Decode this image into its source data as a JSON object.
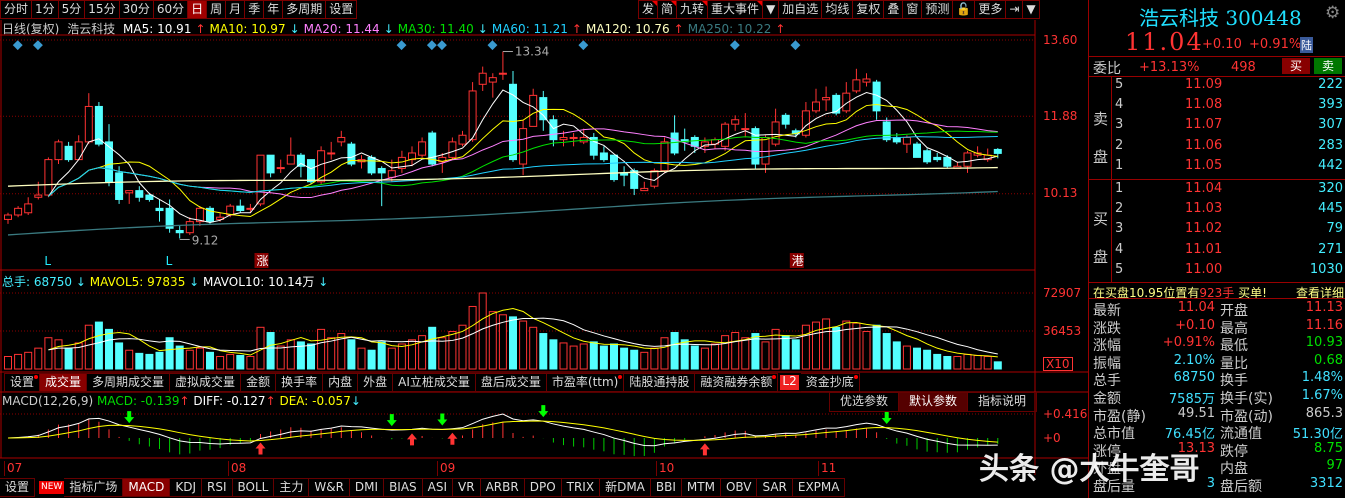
{
  "toolbar": {
    "left": [
      "分时",
      "1分",
      "5分",
      "15分",
      "30分",
      "60分",
      "日",
      "周",
      "月",
      "季",
      "年",
      "多周期",
      "设置"
    ],
    "active": "日",
    "right": [
      "发",
      "简",
      "九转",
      "重大事件",
      "▼",
      "加自选",
      "均线",
      "复权",
      "叠",
      "窗",
      "预测",
      "🔓",
      "更多",
      "⇥",
      "▼"
    ]
  },
  "ma_legend": {
    "prefix": "日线(复权)",
    "name": "浩云科技",
    "items": [
      {
        "label": "MA5: 10.91",
        "dir": "↑",
        "color": "#ffffff"
      },
      {
        "label": "MA10: 10.97",
        "dir": "↓",
        "color": "#ffff00"
      },
      {
        "label": "MA20: 11.44",
        "dir": "↓",
        "color": "#ff80ff"
      },
      {
        "label": "MA30: 11.40",
        "dir": "↓",
        "color": "#00e000"
      },
      {
        "label": "MA60: 11.21",
        "dir": "↑",
        "color": "#20d0ff"
      },
      {
        "label": "MA120: 10.76",
        "dir": "↑",
        "color": "#ffffc0"
      },
      {
        "label": "MA250: 10.22",
        "dir": "↑",
        "color": "#3a7a80"
      }
    ]
  },
  "price_axis": [
    "13.60",
    "11.88",
    "10.13"
  ],
  "vol_legend": {
    "total": "总手: 68750",
    "mavol5": "MAVOL5: 97835",
    "mavol10": "MAVOL10: 10.14万"
  },
  "vol_axis": [
    "72907",
    "36453"
  ],
  "vol_unit": "X10",
  "indicator_tabs": [
    "设置",
    "成交量",
    "多周期成交量",
    "虚拟成交量",
    "金额",
    "换手率",
    "内盘",
    "外盘",
    "AI立桩成交量",
    "盘后成交量",
    "市盈率(ttm)",
    "陆股通持股",
    "融资融券余额",
    "资金抄底"
  ],
  "indicator_active": "成交量",
  "l2_badge": "L2",
  "macd_legend": {
    "name": "MACD(12,26,9)",
    "macd": "MACD: -0.139",
    "diff": "DIFF: -0.127",
    "dea": "DEA: -0.057"
  },
  "macd_buttons": [
    "优选参数",
    "默认参数",
    "指标说明"
  ],
  "macd_axis": [
    "+0.416",
    "+0"
  ],
  "months": [
    "07",
    "08",
    "09",
    "10",
    "11"
  ],
  "bottom_tabs": [
    "设置",
    "指标广场",
    "MACD",
    "KDJ",
    "RSI",
    "BOLL",
    "主力",
    "W&R",
    "DMI",
    "BIAS",
    "ASI",
    "VR",
    "ARBR",
    "DPO",
    "TRIX",
    "新DMA",
    "BBI",
    "MTM",
    "OBV",
    "SAR",
    "EXPMA"
  ],
  "new_badge": "NEW",
  "bottom_active": "MACD",
  "quote": {
    "name": "浩云科技",
    "code": "300448",
    "price": "11.04",
    "change": "+0.10",
    "pct": "+0.91%",
    "badge": "陆",
    "weibi_label": "委比",
    "weibi": "+13.13%",
    "weicha": "498",
    "buy_btn": "买",
    "sell_btn": "卖",
    "sell_label": [
      "卖",
      "盘"
    ],
    "buy_label": [
      "买",
      "盘"
    ],
    "sell": [
      {
        "lvl": "5",
        "p": "11.09",
        "v": "222"
      },
      {
        "lvl": "4",
        "p": "11.08",
        "v": "393"
      },
      {
        "lvl": "3",
        "p": "11.07",
        "v": "307"
      },
      {
        "lvl": "2",
        "p": "11.06",
        "v": "283"
      },
      {
        "lvl": "1",
        "p": "11.05",
        "v": "442"
      }
    ],
    "buy": [
      {
        "lvl": "1",
        "p": "11.04",
        "v": "320"
      },
      {
        "lvl": "2",
        "p": "11.03",
        "v": "445"
      },
      {
        "lvl": "3",
        "p": "11.02",
        "v": "79"
      },
      {
        "lvl": "4",
        "p": "11.01",
        "v": "271"
      },
      {
        "lvl": "5",
        "p": "11.00",
        "v": "1030"
      }
    ],
    "notice_a": "在买盘10.95位置有",
    "notice_b": "923手",
    "notice_c": "买单!",
    "notice_link": "查看详细",
    "stats": [
      [
        "最新",
        "11.04",
        "#ff3333",
        "开盘",
        "11.13",
        "#ff3333"
      ],
      [
        "涨跌",
        "+0.10",
        "#ff3333",
        "最高",
        "11.16",
        "#ff3333"
      ],
      [
        "涨幅",
        "+0.91%",
        "#ff3333",
        "最低",
        "10.93",
        "#00e000"
      ],
      [
        "振幅",
        "2.10%",
        "#40e0ff",
        "量比",
        "0.68",
        "#00e000"
      ],
      [
        "总手",
        "68750",
        "#40e0ff",
        "换手",
        "1.48%",
        "#40e0ff"
      ],
      [
        "金额",
        "7585万",
        "#40e0ff",
        "换手(实)",
        "1.67%",
        "#40e0ff"
      ],
      [
        "市盈(静)",
        "49.51",
        "#cccccc",
        "市盈(动)",
        "865.3",
        "#cccccc"
      ],
      [
        "总市值",
        "76.45亿",
        "#40e0ff",
        "流通值",
        "51.30亿",
        "#40e0ff"
      ],
      [
        "涨停",
        "13.13",
        "#ff3333",
        "跌停",
        "8.75",
        "#00e000"
      ],
      [
        "外盘",
        "",
        "#ff3333",
        "内盘",
        "97",
        "#00e000"
      ],
      [
        "盘后量",
        "3",
        "#40e0ff",
        "盘后额",
        "3312",
        "#40e0ff"
      ]
    ]
  },
  "watermark": "头条 @大牛奎哥",
  "colors": {
    "up": "#ff3333",
    "down": "#54ffff",
    "grid": "#8b0000"
  },
  "chart_data": {
    "type": "candlestick",
    "title": "浩云科技 日线(复权)",
    "ylim": [
      8.2,
      14.0
    ],
    "ohlc": [
      [
        9.55,
        9.65,
        9.7,
        9.45
      ],
      [
        9.65,
        9.8,
        9.85,
        9.6
      ],
      [
        9.7,
        9.9,
        10.05,
        9.65
      ],
      [
        10.05,
        10.1,
        10.4,
        10.0
      ],
      [
        10.1,
        10.9,
        10.95,
        10.05
      ],
      [
        10.9,
        11.3,
        11.35,
        10.8
      ],
      [
        11.2,
        10.9,
        11.3,
        10.85
      ],
      [
        10.9,
        11.3,
        11.45,
        10.9
      ],
      [
        11.3,
        12.1,
        12.4,
        11.25
      ],
      [
        12.1,
        11.25,
        12.2,
        11.2
      ],
      [
        11.3,
        10.4,
        11.7,
        10.3
      ],
      [
        10.6,
        10.0,
        10.75,
        9.9
      ],
      [
        10.15,
        10.2,
        10.2,
        9.9
      ],
      [
        10.2,
        10.05,
        10.3,
        9.95
      ],
      [
        10.1,
        10.0,
        10.15,
        9.95
      ],
      [
        9.8,
        9.75,
        10.0,
        9.5
      ],
      [
        9.8,
        9.35,
        10.0,
        9.25
      ],
      [
        9.3,
        9.25,
        9.4,
        9.12
      ],
      [
        9.25,
        9.5,
        9.6,
        9.2
      ],
      [
        9.5,
        9.8,
        9.85,
        9.4
      ],
      [
        9.8,
        9.5,
        9.85,
        9.45
      ],
      [
        9.55,
        9.6,
        9.7,
        9.5
      ],
      [
        9.65,
        9.85,
        9.9,
        9.6
      ],
      [
        9.85,
        9.75,
        10.0,
        9.7
      ],
      [
        9.78,
        9.8,
        9.9,
        9.7
      ],
      [
        9.9,
        11.0,
        11.0,
        9.85
      ],
      [
        11.0,
        10.6,
        11.0,
        10.5
      ],
      [
        10.7,
        10.72,
        10.9,
        10.6
      ],
      [
        10.8,
        11.0,
        11.4,
        10.8
      ],
      [
        11.0,
        10.75,
        11.05,
        10.5
      ],
      [
        10.9,
        10.4,
        10.9,
        10.35
      ],
      [
        10.4,
        11.1,
        11.2,
        10.35
      ],
      [
        11.05,
        11.05,
        11.3,
        10.9
      ],
      [
        11.3,
        11.4,
        11.55,
        11.2
      ],
      [
        11.25,
        10.8,
        11.3,
        10.75
      ],
      [
        10.85,
        10.9,
        11.0,
        10.7
      ],
      [
        10.95,
        10.6,
        11.0,
        10.55
      ],
      [
        10.7,
        10.6,
        10.75,
        9.85
      ],
      [
        10.5,
        10.65,
        10.9,
        10.4
      ],
      [
        10.7,
        10.95,
        11.1,
        10.6
      ],
      [
        10.9,
        11.05,
        11.2,
        10.75
      ],
      [
        11.0,
        11.3,
        11.4,
        10.95
      ],
      [
        11.5,
        10.8,
        11.55,
        10.75
      ],
      [
        10.85,
        10.95,
        11.05,
        10.6
      ],
      [
        10.95,
        11.3,
        11.4,
        10.9
      ],
      [
        11.25,
        11.45,
        11.55,
        11.2
      ],
      [
        11.35,
        12.45,
        12.65,
        11.3
      ],
      [
        12.6,
        12.85,
        13.0,
        12.45
      ],
      [
        12.65,
        12.75,
        12.85,
        12.3
      ],
      [
        12.85,
        12.85,
        13.34,
        12.7
      ],
      [
        12.6,
        10.9,
        12.9,
        10.85
      ],
      [
        10.8,
        11.6,
        11.8,
        10.55
      ],
      [
        11.65,
        12.35,
        12.5,
        11.65
      ],
      [
        12.3,
        11.8,
        12.45,
        11.55
      ],
      [
        11.8,
        11.35,
        11.9,
        11.2
      ],
      [
        11.35,
        11.4,
        11.55,
        11.2
      ],
      [
        11.4,
        11.4,
        11.5,
        11.2
      ],
      [
        11.3,
        11.4,
        11.6,
        11.25
      ],
      [
        11.4,
        11.0,
        11.5,
        10.9
      ],
      [
        11.05,
        10.9,
        11.2,
        10.85
      ],
      [
        11.0,
        10.45,
        11.0,
        10.4
      ],
      [
        10.6,
        10.55,
        10.75,
        10.3
      ],
      [
        10.65,
        10.25,
        10.7,
        10.1
      ],
      [
        10.2,
        10.25,
        10.4,
        10.2
      ],
      [
        10.3,
        10.65,
        10.7,
        10.25
      ],
      [
        10.65,
        11.3,
        11.4,
        10.6
      ],
      [
        11.5,
        11.05,
        11.9,
        11.0
      ],
      [
        11.35,
        11.3,
        11.6,
        11.1
      ],
      [
        11.4,
        11.2,
        11.45,
        11.05
      ],
      [
        11.2,
        11.3,
        11.4,
        11.05
      ],
      [
        11.25,
        11.35,
        11.4,
        11.15
      ],
      [
        11.2,
        11.7,
        11.75,
        11.1
      ],
      [
        11.7,
        11.8,
        11.9,
        11.55
      ],
      [
        11.6,
        11.6,
        11.95,
        11.4
      ],
      [
        11.6,
        10.8,
        11.65,
        10.7
      ],
      [
        10.8,
        11.4,
        11.45,
        10.6
      ],
      [
        11.25,
        11.75,
        12.05,
        11.2
      ],
      [
        11.9,
        11.7,
        11.95,
        11.6
      ],
      [
        11.55,
        11.48,
        11.6,
        11.4
      ],
      [
        11.45,
        12.0,
        12.2,
        11.4
      ],
      [
        12.0,
        12.2,
        12.5,
        11.95
      ],
      [
        12.25,
        12.3,
        12.55,
        12.0
      ],
      [
        12.35,
        11.95,
        12.4,
        11.9
      ],
      [
        12.0,
        12.4,
        12.65,
        11.95
      ],
      [
        12.45,
        12.7,
        12.95,
        12.4
      ],
      [
        12.65,
        12.72,
        12.85,
        12.55
      ],
      [
        12.65,
        12.0,
        12.7,
        11.8
      ],
      [
        11.75,
        11.35,
        11.85,
        11.3
      ],
      [
        11.4,
        11.3,
        11.5,
        11.25
      ],
      [
        11.25,
        11.4,
        11.45,
        11.05
      ],
      [
        11.25,
        10.95,
        11.3,
        10.95
      ],
      [
        11.1,
        10.85,
        11.15,
        10.8
      ],
      [
        10.95,
        10.9,
        11.05,
        10.85
      ],
      [
        10.95,
        10.75,
        11.0,
        10.7
      ],
      [
        10.7,
        10.75,
        10.85,
        10.7
      ],
      [
        10.75,
        11.05,
        11.1,
        10.6
      ],
      [
        11.0,
        11.05,
        11.2,
        10.95
      ],
      [
        10.9,
        11.0,
        11.15,
        10.85
      ],
      [
        11.13,
        11.04,
        11.16,
        10.93
      ]
    ],
    "volume": [
      12000,
      14000,
      16000,
      20000,
      30000,
      28000,
      20000,
      25000,
      42000,
      45000,
      38000,
      25000,
      18000,
      15000,
      14000,
      16000,
      30000,
      22000,
      18000,
      20000,
      16000,
      12000,
      14000,
      13000,
      12000,
      40000,
      35000,
      22000,
      28000,
      26000,
      24000,
      38000,
      30000,
      34000,
      28000,
      20000,
      18000,
      26000,
      20000,
      24000,
      28000,
      32000,
      40000,
      30000,
      36000,
      42000,
      60000,
      72907,
      55000,
      52000,
      50000,
      46000,
      40000,
      34000,
      28000,
      25000,
      22000,
      24000,
      26000,
      22000,
      24000,
      20000,
      18000,
      16000,
      20000,
      30000,
      35000,
      28000,
      22000,
      20000,
      24000,
      32000,
      35000,
      30000,
      34000,
      26000,
      38000,
      32000,
      28000,
      42000,
      45000,
      48000,
      40000,
      46000,
      44000,
      36000,
      42000,
      34000,
      26000,
      22000,
      20000,
      18000,
      14000,
      12000,
      12000,
      14000,
      13000,
      12000,
      6875
    ],
    "ma120": [
      10.3,
      10.76
    ],
    "ma250": [
      9.2,
      10.22
    ],
    "diamonds": [
      1,
      3,
      39,
      42,
      43,
      48,
      57,
      72,
      78
    ],
    "markers": [
      {
        "i": 4,
        "t": "L"
      },
      {
        "i": 16,
        "t": "L"
      },
      {
        "i": 25,
        "t": "涨"
      },
      {
        "i": 78,
        "t": "港"
      }
    ],
    "low_label": "9.12",
    "high_label": "13.34",
    "low_index": 17,
    "high_index": 49
  }
}
